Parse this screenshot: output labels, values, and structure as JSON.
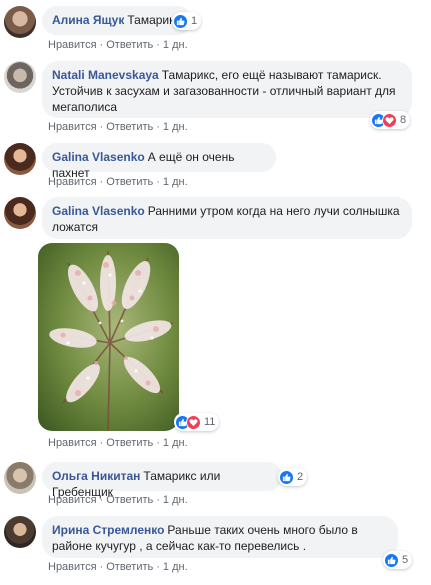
{
  "actions": {
    "like": "Нравится",
    "reply": "Ответить",
    "sep": "·"
  },
  "comments": [
    {
      "author": "Алина Ящук",
      "text": "Тамарикс",
      "time": "1 дн.",
      "reaction_count": "1"
    },
    {
      "author": "Natali Manevskaya",
      "text": "Тамарикс, его ещё называют тамариск. Устойчив к засухам и загазованности - отличный вариант для мегаполиса",
      "time": "1 дн.",
      "reaction_count": "8"
    },
    {
      "author": "Galina Vlasenko",
      "text": "А ещё он очень пахнет",
      "time": "1 дн."
    },
    {
      "author": "Galina Vlasenko",
      "text": "Ранними утром когда на него лучи солнышка ложатся",
      "time": "1 дн.",
      "reaction_count": "11"
    },
    {
      "author": "Ольга Никитан",
      "text": "Тамарикс или Гребенщик",
      "time": "1 дн.",
      "reaction_count": "2"
    },
    {
      "author": "Ирина Стремленко",
      "text": "Раньше таких очень много было в районе кучугур , а сейчас как-то перевелись .",
      "time": "1 дн.",
      "reaction_count": "5"
    }
  ],
  "colors": {
    "author": "#385898",
    "bubble": "#f2f3f5",
    "meta": "#606770",
    "like": "#1877f2",
    "love": "#f33e58"
  },
  "icons": {
    "like": "like-icon",
    "love": "love-icon"
  }
}
